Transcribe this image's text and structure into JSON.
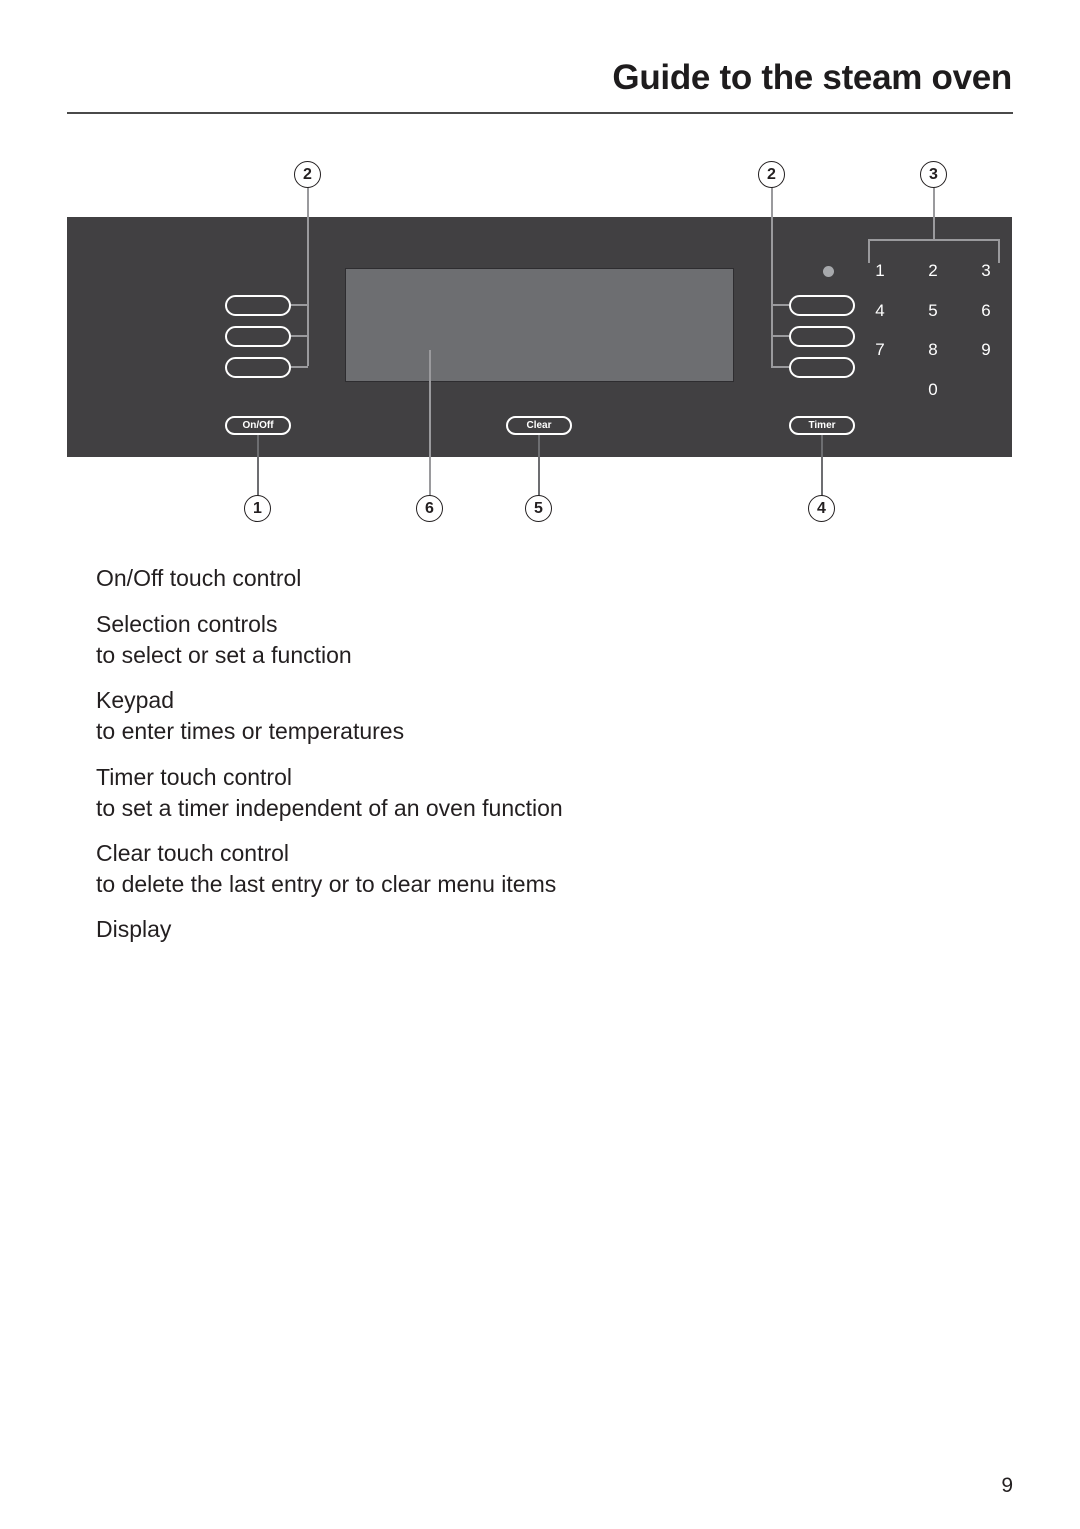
{
  "header": {
    "title": "Guide to the steam oven"
  },
  "control_panel": {
    "buttons": {
      "on_off": "On/Off",
      "clear": "Clear",
      "timer": "Timer"
    },
    "keypad": [
      "1",
      "2",
      "3",
      "4",
      "5",
      "6",
      "7",
      "8",
      "9",
      "0"
    ],
    "callouts": {
      "on_off": "1",
      "selection_left": "2",
      "selection_right": "2",
      "keypad": "3",
      "timer": "4",
      "clear": "5",
      "display": "6"
    }
  },
  "legend": [
    {
      "title": "On/Off touch control",
      "description": ""
    },
    {
      "title": "Selection controls",
      "description": "to select or set a function"
    },
    {
      "title": "Keypad",
      "description": "to enter times or temperatures"
    },
    {
      "title": "Timer touch control",
      "description": "to set a timer independent of an oven function"
    },
    {
      "title": "Clear touch control",
      "description": "to delete the last entry or to clear menu items"
    },
    {
      "title": "Display",
      "description": ""
    }
  ],
  "footer": {
    "page_number": "9"
  }
}
